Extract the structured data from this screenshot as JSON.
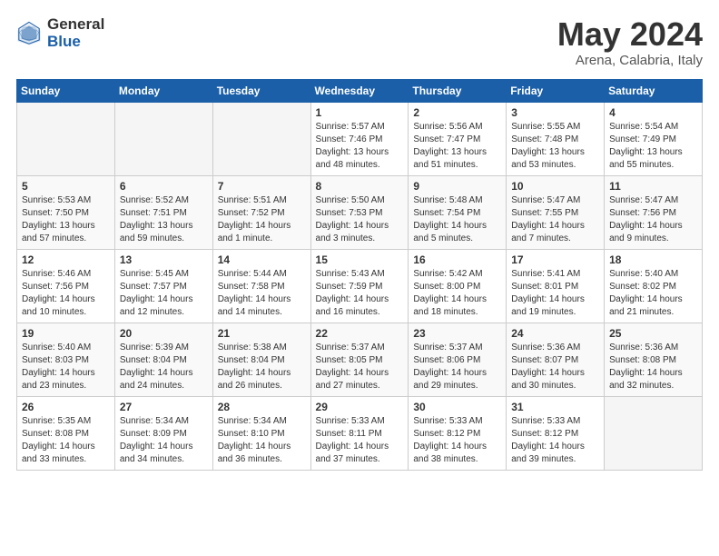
{
  "header": {
    "logo_general": "General",
    "logo_blue": "Blue",
    "month_title": "May 2024",
    "location": "Arena, Calabria, Italy"
  },
  "days_of_week": [
    "Sunday",
    "Monday",
    "Tuesday",
    "Wednesday",
    "Thursday",
    "Friday",
    "Saturday"
  ],
  "weeks": [
    [
      {
        "day": "",
        "info": ""
      },
      {
        "day": "",
        "info": ""
      },
      {
        "day": "",
        "info": ""
      },
      {
        "day": "1",
        "info": "Sunrise: 5:57 AM\nSunset: 7:46 PM\nDaylight: 13 hours\nand 48 minutes."
      },
      {
        "day": "2",
        "info": "Sunrise: 5:56 AM\nSunset: 7:47 PM\nDaylight: 13 hours\nand 51 minutes."
      },
      {
        "day": "3",
        "info": "Sunrise: 5:55 AM\nSunset: 7:48 PM\nDaylight: 13 hours\nand 53 minutes."
      },
      {
        "day": "4",
        "info": "Sunrise: 5:54 AM\nSunset: 7:49 PM\nDaylight: 13 hours\nand 55 minutes."
      }
    ],
    [
      {
        "day": "5",
        "info": "Sunrise: 5:53 AM\nSunset: 7:50 PM\nDaylight: 13 hours\nand 57 minutes."
      },
      {
        "day": "6",
        "info": "Sunrise: 5:52 AM\nSunset: 7:51 PM\nDaylight: 13 hours\nand 59 minutes."
      },
      {
        "day": "7",
        "info": "Sunrise: 5:51 AM\nSunset: 7:52 PM\nDaylight: 14 hours\nand 1 minute."
      },
      {
        "day": "8",
        "info": "Sunrise: 5:50 AM\nSunset: 7:53 PM\nDaylight: 14 hours\nand 3 minutes."
      },
      {
        "day": "9",
        "info": "Sunrise: 5:48 AM\nSunset: 7:54 PM\nDaylight: 14 hours\nand 5 minutes."
      },
      {
        "day": "10",
        "info": "Sunrise: 5:47 AM\nSunset: 7:55 PM\nDaylight: 14 hours\nand 7 minutes."
      },
      {
        "day": "11",
        "info": "Sunrise: 5:47 AM\nSunset: 7:56 PM\nDaylight: 14 hours\nand 9 minutes."
      }
    ],
    [
      {
        "day": "12",
        "info": "Sunrise: 5:46 AM\nSunset: 7:56 PM\nDaylight: 14 hours\nand 10 minutes."
      },
      {
        "day": "13",
        "info": "Sunrise: 5:45 AM\nSunset: 7:57 PM\nDaylight: 14 hours\nand 12 minutes."
      },
      {
        "day": "14",
        "info": "Sunrise: 5:44 AM\nSunset: 7:58 PM\nDaylight: 14 hours\nand 14 minutes."
      },
      {
        "day": "15",
        "info": "Sunrise: 5:43 AM\nSunset: 7:59 PM\nDaylight: 14 hours\nand 16 minutes."
      },
      {
        "day": "16",
        "info": "Sunrise: 5:42 AM\nSunset: 8:00 PM\nDaylight: 14 hours\nand 18 minutes."
      },
      {
        "day": "17",
        "info": "Sunrise: 5:41 AM\nSunset: 8:01 PM\nDaylight: 14 hours\nand 19 minutes."
      },
      {
        "day": "18",
        "info": "Sunrise: 5:40 AM\nSunset: 8:02 PM\nDaylight: 14 hours\nand 21 minutes."
      }
    ],
    [
      {
        "day": "19",
        "info": "Sunrise: 5:40 AM\nSunset: 8:03 PM\nDaylight: 14 hours\nand 23 minutes."
      },
      {
        "day": "20",
        "info": "Sunrise: 5:39 AM\nSunset: 8:04 PM\nDaylight: 14 hours\nand 24 minutes."
      },
      {
        "day": "21",
        "info": "Sunrise: 5:38 AM\nSunset: 8:04 PM\nDaylight: 14 hours\nand 26 minutes."
      },
      {
        "day": "22",
        "info": "Sunrise: 5:37 AM\nSunset: 8:05 PM\nDaylight: 14 hours\nand 27 minutes."
      },
      {
        "day": "23",
        "info": "Sunrise: 5:37 AM\nSunset: 8:06 PM\nDaylight: 14 hours\nand 29 minutes."
      },
      {
        "day": "24",
        "info": "Sunrise: 5:36 AM\nSunset: 8:07 PM\nDaylight: 14 hours\nand 30 minutes."
      },
      {
        "day": "25",
        "info": "Sunrise: 5:36 AM\nSunset: 8:08 PM\nDaylight: 14 hours\nand 32 minutes."
      }
    ],
    [
      {
        "day": "26",
        "info": "Sunrise: 5:35 AM\nSunset: 8:08 PM\nDaylight: 14 hours\nand 33 minutes."
      },
      {
        "day": "27",
        "info": "Sunrise: 5:34 AM\nSunset: 8:09 PM\nDaylight: 14 hours\nand 34 minutes."
      },
      {
        "day": "28",
        "info": "Sunrise: 5:34 AM\nSunset: 8:10 PM\nDaylight: 14 hours\nand 36 minutes."
      },
      {
        "day": "29",
        "info": "Sunrise: 5:33 AM\nSunset: 8:11 PM\nDaylight: 14 hours\nand 37 minutes."
      },
      {
        "day": "30",
        "info": "Sunrise: 5:33 AM\nSunset: 8:12 PM\nDaylight: 14 hours\nand 38 minutes."
      },
      {
        "day": "31",
        "info": "Sunrise: 5:33 AM\nSunset: 8:12 PM\nDaylight: 14 hours\nand 39 minutes."
      },
      {
        "day": "",
        "info": ""
      }
    ]
  ]
}
